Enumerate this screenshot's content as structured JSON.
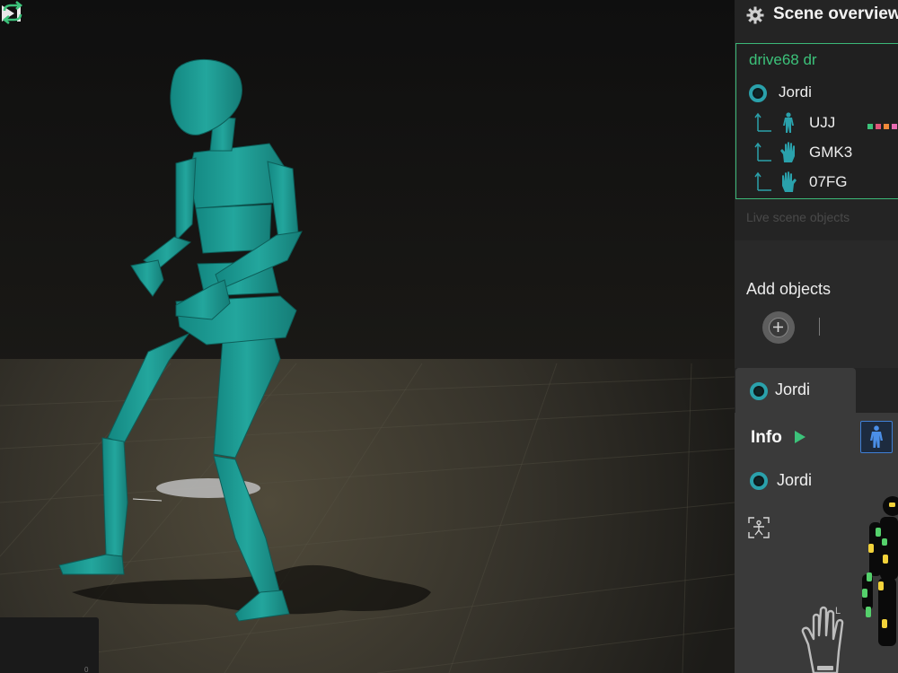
{
  "panel": {
    "title": "Scene overview",
    "scene_name": "drive68 dr",
    "objects": [
      {
        "label": "Jordi",
        "kind": "actor",
        "icon": "radio-ring-icon"
      },
      {
        "label": "UJJ",
        "kind": "body",
        "icon": "body-suit-icon"
      },
      {
        "label": "GMK3",
        "kind": "glove",
        "icon": "glove-icon"
      },
      {
        "label": "07FG",
        "kind": "glove",
        "icon": "glove-icon"
      }
    ],
    "live_scene_objects": "Live scene objects",
    "add_objects": "Add objects",
    "selected_tab": "Jordi",
    "info": {
      "title": "Info",
      "object_label": "Jordi",
      "hand_side": "L"
    }
  },
  "playback": {
    "frame_hint": "0"
  },
  "colors": {
    "accent_green": "#3cb878",
    "ring_teal": "#2aa1ab",
    "mannequin": "#1f9e96",
    "body_mode_blue": "#3f7fd6",
    "sensor_yellow": "#f2d23a",
    "sensor_green": "#55d16c",
    "color_dots": [
      "#3cc27a",
      "#e0557a",
      "#f08a3a",
      "#e86ab0"
    ]
  }
}
